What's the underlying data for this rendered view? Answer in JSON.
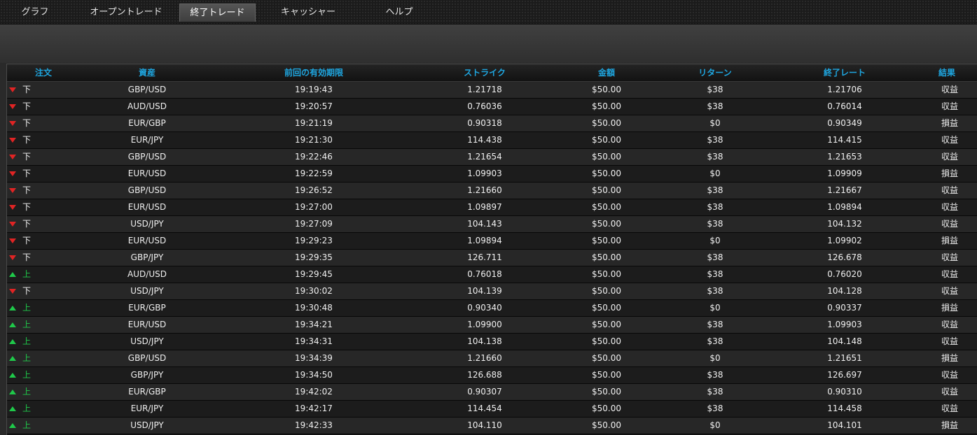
{
  "nav": {
    "tabs": [
      {
        "label": "グラフ",
        "active": false
      },
      {
        "label": "オープントレード",
        "active": false
      },
      {
        "label": "終了トレード",
        "active": true
      },
      {
        "label": "キャッシャー",
        "active": false
      },
      {
        "label": "ヘルプ",
        "active": false
      }
    ]
  },
  "colors": {
    "header_text": "#1ea6e0",
    "up": "#1fc94a",
    "down": "#e02424"
  },
  "table": {
    "columns": [
      "注文",
      "資産",
      "前回の有効期限",
      "ストライク",
      "金額",
      "リターン",
      "終了レート",
      "結果"
    ],
    "rows": [
      {
        "direction": "down",
        "order": "下",
        "asset": "GBP/USD",
        "expiry": "19:19:43",
        "strike": "1.21718",
        "amount": "$50.00",
        "return": "$38",
        "close_rate": "1.21706",
        "result": "収益"
      },
      {
        "direction": "down",
        "order": "下",
        "asset": "AUD/USD",
        "expiry": "19:20:57",
        "strike": "0.76036",
        "amount": "$50.00",
        "return": "$38",
        "close_rate": "0.76014",
        "result": "収益"
      },
      {
        "direction": "down",
        "order": "下",
        "asset": "EUR/GBP",
        "expiry": "19:21:19",
        "strike": "0.90318",
        "amount": "$50.00",
        "return": "$0",
        "close_rate": "0.90349",
        "result": "損益"
      },
      {
        "direction": "down",
        "order": "下",
        "asset": "EUR/JPY",
        "expiry": "19:21:30",
        "strike": "114.438",
        "amount": "$50.00",
        "return": "$38",
        "close_rate": "114.415",
        "result": "収益"
      },
      {
        "direction": "down",
        "order": "下",
        "asset": "GBP/USD",
        "expiry": "19:22:46",
        "strike": "1.21654",
        "amount": "$50.00",
        "return": "$38",
        "close_rate": "1.21653",
        "result": "収益"
      },
      {
        "direction": "down",
        "order": "下",
        "asset": "EUR/USD",
        "expiry": "19:22:59",
        "strike": "1.09903",
        "amount": "$50.00",
        "return": "$0",
        "close_rate": "1.09909",
        "result": "損益"
      },
      {
        "direction": "down",
        "order": "下",
        "asset": "GBP/USD",
        "expiry": "19:26:52",
        "strike": "1.21660",
        "amount": "$50.00",
        "return": "$38",
        "close_rate": "1.21667",
        "result": "収益"
      },
      {
        "direction": "down",
        "order": "下",
        "asset": "EUR/USD",
        "expiry": "19:27:00",
        "strike": "1.09897",
        "amount": "$50.00",
        "return": "$38",
        "close_rate": "1.09894",
        "result": "収益"
      },
      {
        "direction": "down",
        "order": "下",
        "asset": "USD/JPY",
        "expiry": "19:27:09",
        "strike": "104.143",
        "amount": "$50.00",
        "return": "$38",
        "close_rate": "104.132",
        "result": "収益"
      },
      {
        "direction": "down",
        "order": "下",
        "asset": "EUR/USD",
        "expiry": "19:29:23",
        "strike": "1.09894",
        "amount": "$50.00",
        "return": "$0",
        "close_rate": "1.09902",
        "result": "損益"
      },
      {
        "direction": "down",
        "order": "下",
        "asset": "GBP/JPY",
        "expiry": "19:29:35",
        "strike": "126.711",
        "amount": "$50.00",
        "return": "$38",
        "close_rate": "126.678",
        "result": "収益"
      },
      {
        "direction": "up",
        "order": "上",
        "asset": "AUD/USD",
        "expiry": "19:29:45",
        "strike": "0.76018",
        "amount": "$50.00",
        "return": "$38",
        "close_rate": "0.76020",
        "result": "収益"
      },
      {
        "direction": "down",
        "order": "下",
        "asset": "USD/JPY",
        "expiry": "19:30:02",
        "strike": "104.139",
        "amount": "$50.00",
        "return": "$38",
        "close_rate": "104.128",
        "result": "収益"
      },
      {
        "direction": "up",
        "order": "上",
        "asset": "EUR/GBP",
        "expiry": "19:30:48",
        "strike": "0.90340",
        "amount": "$50.00",
        "return": "$0",
        "close_rate": "0.90337",
        "result": "損益"
      },
      {
        "direction": "up",
        "order": "上",
        "asset": "EUR/USD",
        "expiry": "19:34:21",
        "strike": "1.09900",
        "amount": "$50.00",
        "return": "$38",
        "close_rate": "1.09903",
        "result": "収益"
      },
      {
        "direction": "up",
        "order": "上",
        "asset": "USD/JPY",
        "expiry": "19:34:31",
        "strike": "104.138",
        "amount": "$50.00",
        "return": "$38",
        "close_rate": "104.148",
        "result": "収益"
      },
      {
        "direction": "up",
        "order": "上",
        "asset": "GBP/USD",
        "expiry": "19:34:39",
        "strike": "1.21660",
        "amount": "$50.00",
        "return": "$0",
        "close_rate": "1.21651",
        "result": "損益"
      },
      {
        "direction": "up",
        "order": "上",
        "asset": "GBP/JPY",
        "expiry": "19:34:50",
        "strike": "126.688",
        "amount": "$50.00",
        "return": "$38",
        "close_rate": "126.697",
        "result": "収益"
      },
      {
        "direction": "up",
        "order": "上",
        "asset": "EUR/GBP",
        "expiry": "19:42:02",
        "strike": "0.90307",
        "amount": "$50.00",
        "return": "$38",
        "close_rate": "0.90310",
        "result": "収益"
      },
      {
        "direction": "up",
        "order": "上",
        "asset": "EUR/JPY",
        "expiry": "19:42:17",
        "strike": "114.454",
        "amount": "$50.00",
        "return": "$38",
        "close_rate": "114.458",
        "result": "収益"
      },
      {
        "direction": "up",
        "order": "上",
        "asset": "USD/JPY",
        "expiry": "19:42:33",
        "strike": "104.110",
        "amount": "$50.00",
        "return": "$0",
        "close_rate": "104.101",
        "result": "損益"
      }
    ]
  }
}
